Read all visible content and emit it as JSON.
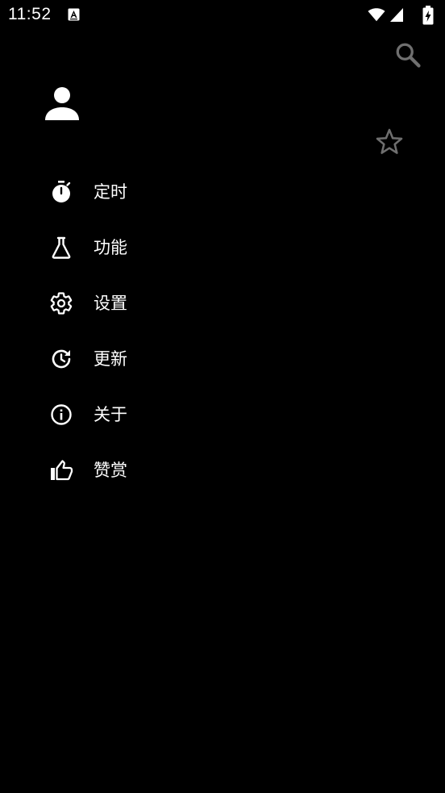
{
  "status_bar": {
    "time": "11:52",
    "app_icon": "a-letter-icon",
    "wifi_icon": "wifi-icon",
    "signal_icon": "signal-icon",
    "battery_icon": "battery-charging-icon"
  },
  "toolbar": {
    "search_icon": "search-icon",
    "star_icon": "star-outline-icon"
  },
  "drawer": {
    "avatar_icon": "person-icon",
    "items": [
      {
        "label": "定时",
        "icon": "timer-icon"
      },
      {
        "label": "功能",
        "icon": "flask-icon"
      },
      {
        "label": "设置",
        "icon": "gear-icon"
      },
      {
        "label": "更新",
        "icon": "update-icon"
      },
      {
        "label": "关于",
        "icon": "info-icon"
      },
      {
        "label": "赞赏",
        "icon": "thumb-up-icon"
      }
    ]
  },
  "colors": {
    "background": "#000000",
    "foreground": "#ffffff",
    "muted_icon": "#6f6f6f"
  }
}
